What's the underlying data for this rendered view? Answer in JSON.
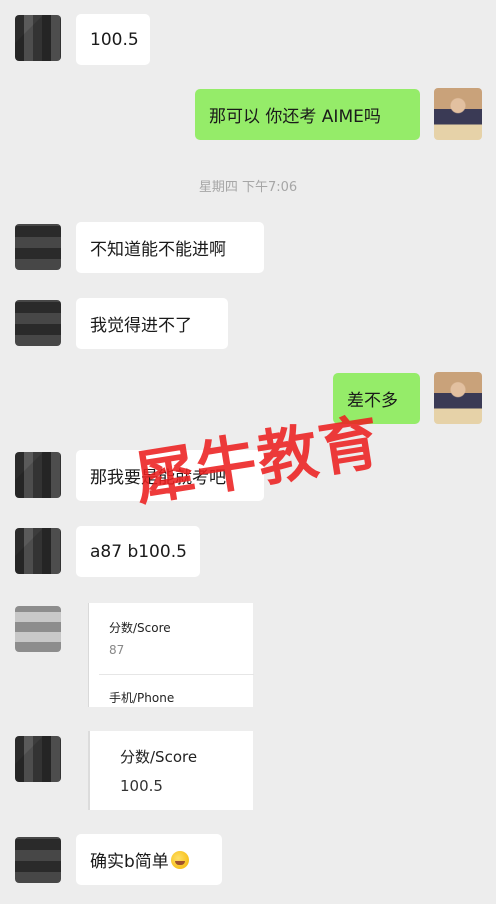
{
  "messages": [
    {
      "text": "100.5"
    },
    {
      "text": "那可以 你还考 AIME吗"
    },
    {
      "text": "不知道能不能进啊"
    },
    {
      "text": "我觉得进不了"
    },
    {
      "text": "差不多"
    },
    {
      "text": "那我要是能就考吧"
    },
    {
      "text": "a87 b100.5"
    },
    {
      "text": "确实b简单"
    }
  ],
  "timestamp": "星期四 下午7:06",
  "score_card_1": {
    "score_label": "分数/Score",
    "score_value": "87",
    "phone_label": "手机/Phone"
  },
  "score_card_2": {
    "score_label": "分数/Score",
    "score_value": "100.5"
  },
  "watermark": "犀牛教育",
  "colors": {
    "background": "#ededed",
    "sent_bubble": "#95ec69",
    "received_bubble": "#ffffff",
    "watermark": "#ec2020"
  },
  "icons": {
    "laugh_emoji": "laughing-with-tears-emoji"
  }
}
